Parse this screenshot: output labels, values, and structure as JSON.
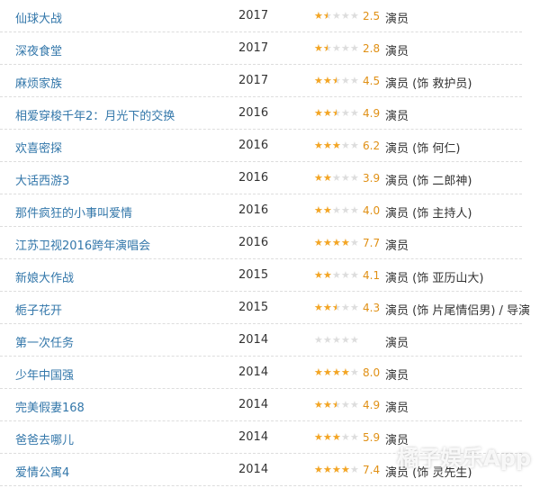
{
  "rows": [
    {
      "title": "仙球大战",
      "year": "2017",
      "stars": 1.5,
      "score": "2.5",
      "role": "演员"
    },
    {
      "title": "深夜食堂",
      "year": "2017",
      "stars": 1.5,
      "score": "2.8",
      "role": "演员"
    },
    {
      "title": "麻烦家族",
      "year": "2017",
      "stars": 2.5,
      "score": "4.5",
      "role": "演员 (饰 救护员)"
    },
    {
      "title": "相爱穿梭千年2：月光下的交换",
      "year": "2016",
      "stars": 2.5,
      "score": "4.9",
      "role": "演员"
    },
    {
      "title": "欢喜密探",
      "year": "2016",
      "stars": 3,
      "score": "6.2",
      "role": "演员 (饰 何仁)"
    },
    {
      "title": "大话西游3",
      "year": "2016",
      "stars": 2,
      "score": "3.9",
      "role": "演员 (饰 二郎神)"
    },
    {
      "title": "那件疯狂的小事叫爱情",
      "year": "2016",
      "stars": 2,
      "score": "4.0",
      "role": "演员 (饰 主持人)"
    },
    {
      "title": "江苏卫视2016跨年演唱会",
      "year": "2016",
      "stars": 4,
      "score": "7.7",
      "role": "演员"
    },
    {
      "title": "新娘大作战",
      "year": "2015",
      "stars": 2,
      "score": "4.1",
      "role": "演员 (饰 亚历山大)"
    },
    {
      "title": "栀子花开",
      "year": "2015",
      "stars": 2.5,
      "score": "4.3",
      "role": "演员 (饰 片尾情侣男) / 导演"
    },
    {
      "title": "第一次任务",
      "year": "2014",
      "stars": 0,
      "score": "",
      "role": "演员"
    },
    {
      "title": "少年中国强",
      "year": "2014",
      "stars": 4,
      "score": "8.0",
      "role": "演员"
    },
    {
      "title": "完美假妻168",
      "year": "2014",
      "stars": 2.5,
      "score": "4.9",
      "role": "演员"
    },
    {
      "title": "爸爸去哪儿",
      "year": "2014",
      "stars": 3,
      "score": "5.9",
      "role": "演员"
    },
    {
      "title": "爱情公寓4",
      "year": "2014",
      "stars": 4,
      "score": "7.4",
      "role": "演员 (饰 灵先生)"
    }
  ],
  "watermark": "橘子娱乐App"
}
